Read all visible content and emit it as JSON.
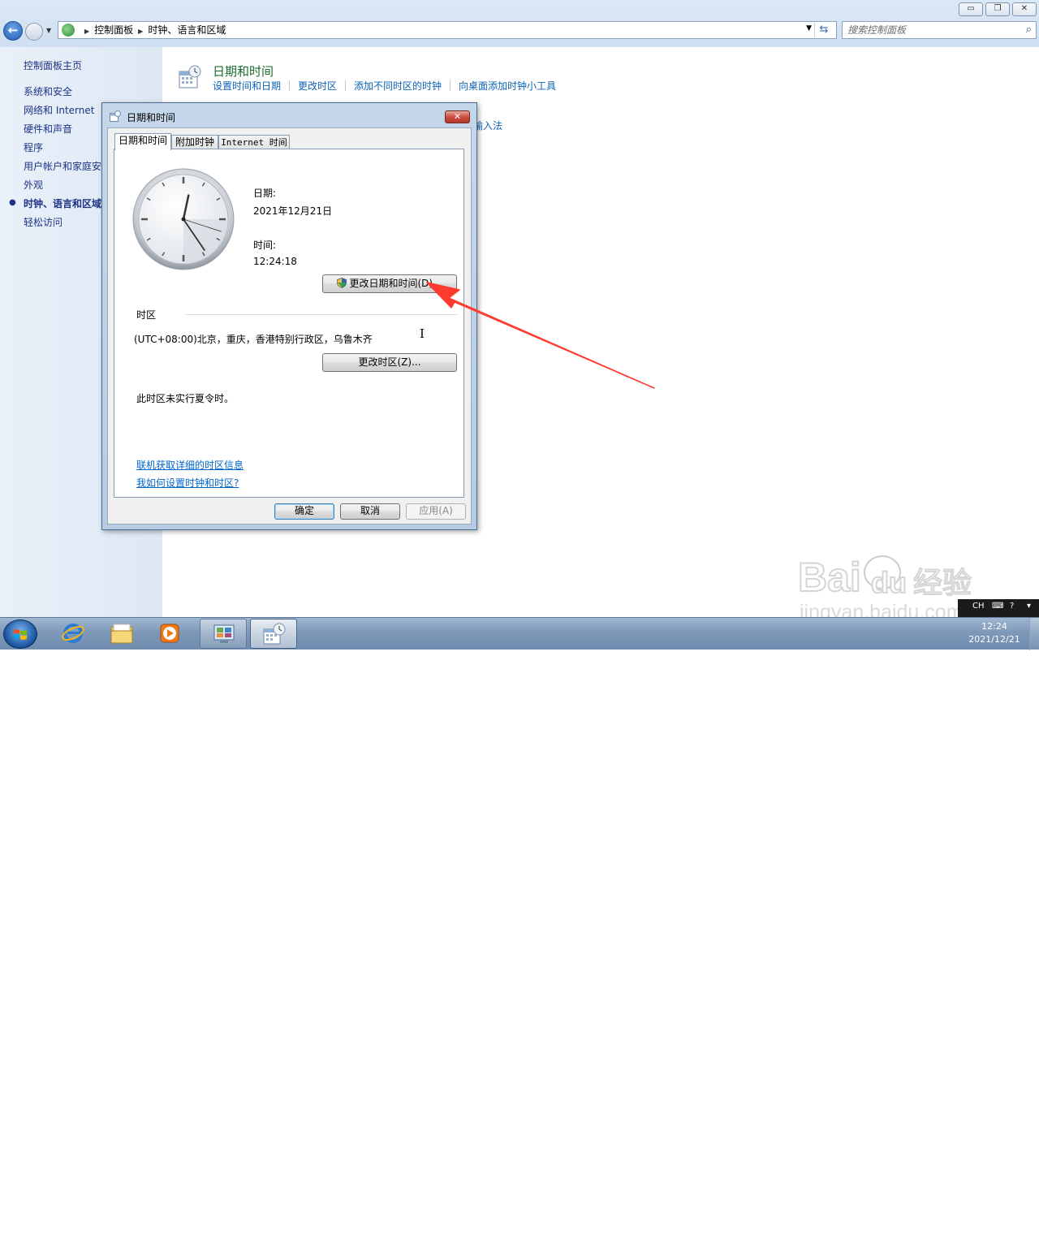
{
  "window": {
    "buttons": {
      "minimize": "▭",
      "maximize": "❐",
      "close": "✕"
    }
  },
  "address_bar": {
    "crumbs": [
      "控制面板",
      "时钟、语言和区域"
    ],
    "search_placeholder": "搜索控制面板"
  },
  "left_nav": {
    "home": "控制面板主页",
    "items": [
      {
        "label": "系统和安全",
        "current": false
      },
      {
        "label": "网络和 Internet",
        "current": false
      },
      {
        "label": "硬件和声音",
        "current": false
      },
      {
        "label": "程序",
        "current": false
      },
      {
        "label": "用户帐户和家庭安",
        "current": false
      },
      {
        "label": "外观",
        "current": false
      },
      {
        "label": "时钟、语言和区域",
        "current": true
      },
      {
        "label": "轻松访问",
        "current": false
      }
    ]
  },
  "main": {
    "section_title": "日期和时间",
    "links": [
      "设置时间和日期",
      "更改时区",
      "添加不同时区的时钟",
      "向桌面添加时钟小工具"
    ],
    "partial_link": "输入法"
  },
  "dialog": {
    "title": "日期和时间",
    "tabs": [
      "日期和时间",
      "附加时钟",
      "Internet 时间"
    ],
    "active_tab": 0,
    "date_label": "日期:",
    "date_value": "2021年12月21日",
    "time_label": "时间:",
    "time_value": "12:24:18",
    "change_datetime_button": "更改日期和时间(D)...",
    "timezone_heading": "时区",
    "timezone_value": "(UTC+08:00)北京，重庆，香港特别行政区，乌鲁木齐",
    "change_timezone_button": "更改时区(Z)...",
    "dst_note": "此时区未实行夏令时。",
    "link_timezone_info": "联机获取详细的时区信息",
    "link_how_to": "我如何设置时钟和时区?",
    "ok_button": "确定",
    "cancel_button": "取消",
    "apply_button": "应用(A)",
    "clock_time": {
      "hour": 12,
      "minute": 24,
      "second": 18
    }
  },
  "taskbar": {
    "apps": [
      "internet-explorer",
      "windows-explorer",
      "media-player",
      "control-panel",
      "date-time"
    ],
    "lang": "CH",
    "tray_time": "12:24",
    "tray_date": "2021/12/21"
  },
  "watermark": {
    "brand": "Bai du 经验",
    "url": "jingyan.baidu.com"
  },
  "colors": {
    "accent_arrow": "#ff3b30",
    "link": "#0d63b8",
    "section_title": "#1d6b2e",
    "nav_text": "#1e3287"
  }
}
